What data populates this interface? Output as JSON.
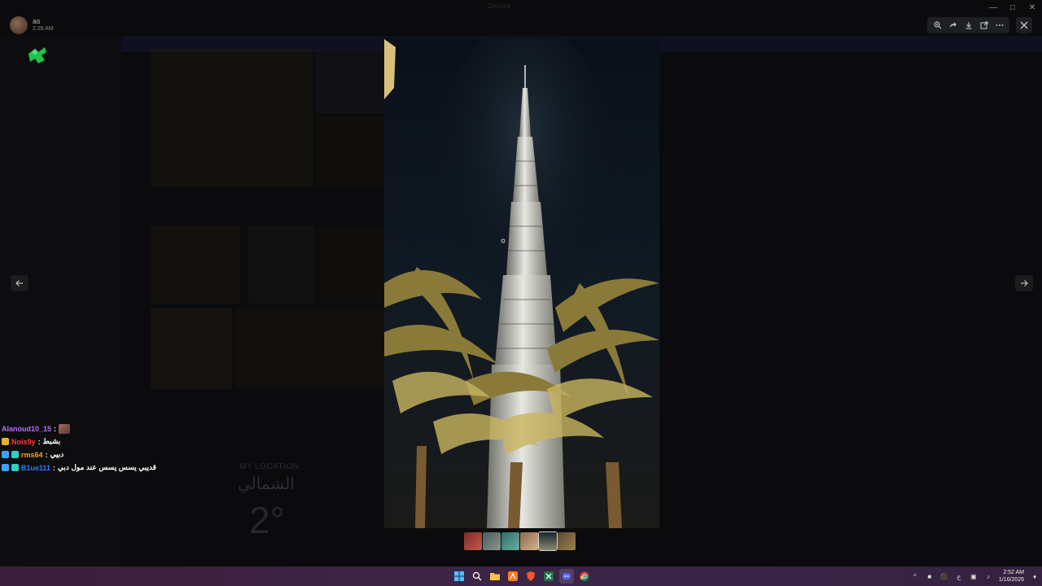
{
  "window": {
    "title": "Discord"
  },
  "profile": {
    "name": "as",
    "time": "2:28 AM"
  },
  "viewer": {
    "toolbar": {
      "zoom_icon": "zoom-in-icon",
      "share_icon": "forward-icon",
      "download_icon": "download-icon",
      "open_icon": "open-external-icon",
      "more_icon": "more-icon"
    },
    "close_icon": "close-icon",
    "prev_icon": "arrow-left-icon",
    "next_icon": "arrow-right-icon",
    "image_subject": "Burj Khalifa at night with palm trees",
    "thumbnails": [
      {
        "color": "#7a2a2a"
      },
      {
        "color": "#4a5a60"
      },
      {
        "color": "#2e6b6a"
      },
      {
        "color": "#8a6a4a"
      },
      {
        "color": "#2a3a4a"
      },
      {
        "color": "#5a4a30"
      }
    ]
  },
  "background": {
    "weather": {
      "title": "MY LOCATION",
      "city": "الشمالي",
      "temp": "2°"
    }
  },
  "chat": [
    {
      "user": "Alanoud10_15",
      "user_color": "#b86cff",
      "message": "",
      "emote": true,
      "badges": []
    },
    {
      "user": "Nois9y",
      "user_color": "#ff3b3b",
      "message": "بشبط",
      "emote": false,
      "badges": [
        "#e6b422"
      ]
    },
    {
      "user": "rms64",
      "user_color": "#ff9f1a",
      "message": "دبيي",
      "emote": false,
      "badges": [
        "#3aa0ff",
        "#2fd0c0"
      ]
    },
    {
      "user": "B1ue111",
      "user_color": "#2f7bff",
      "message": "قديبي يسس يسس عند مول دبي",
      "emote": false,
      "badges": [
        "#3aa0ff",
        "#2fd0c0"
      ]
    }
  ],
  "taskbar": {
    "apps": [
      "windows-icon",
      "search-icon",
      "file-explorer-icon",
      "app-orange-icon",
      "brave-icon",
      "excel-icon",
      "discord-icon",
      "chrome-icon"
    ],
    "tray": {
      "lang": "ع",
      "time": "2:52 AM",
      "date": "1/16/2026"
    }
  }
}
